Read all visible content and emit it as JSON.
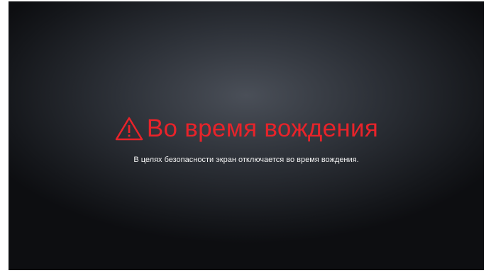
{
  "warning": {
    "icon": "warning-triangle-icon",
    "title": "Во время вождения",
    "message": "В целях безопасности экран отключается во время вождения.",
    "accent_color": "#e8232a"
  }
}
